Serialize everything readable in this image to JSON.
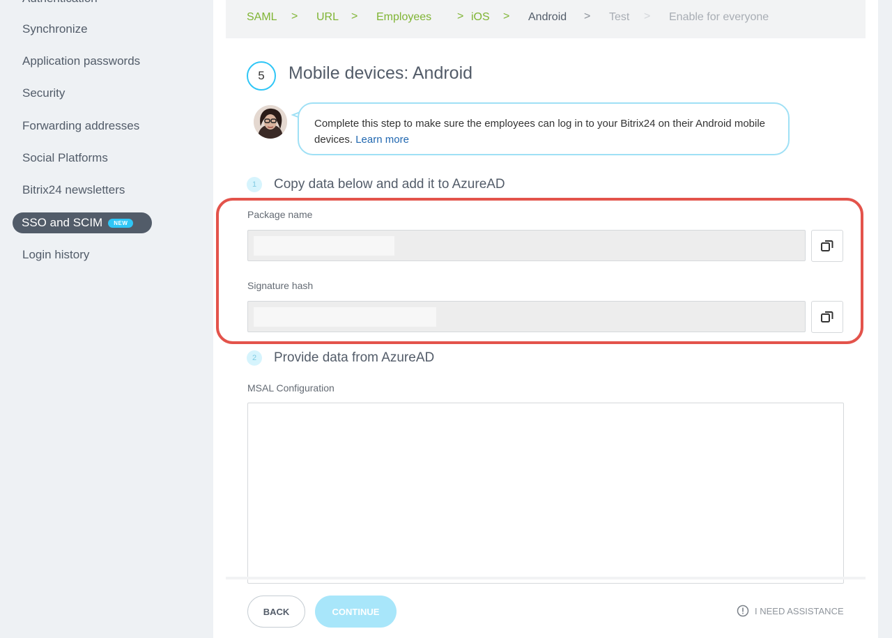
{
  "sidebar": {
    "items": [
      {
        "label": "Authentication"
      },
      {
        "label": "Synchronize"
      },
      {
        "label": "Application passwords"
      },
      {
        "label": "Security"
      },
      {
        "label": "Forwarding addresses"
      },
      {
        "label": "Social Platforms"
      },
      {
        "label": "Bitrix24 newsletters"
      },
      {
        "label": "SSO and SCIM",
        "badge": "NEW",
        "active": true
      },
      {
        "label": "Login history"
      }
    ]
  },
  "breadcrumb": {
    "steps": [
      {
        "label": "SAML",
        "state": "done"
      },
      {
        "label": "URL",
        "state": "done"
      },
      {
        "label": "Employees",
        "state": "done"
      },
      {
        "label": "iOS",
        "state": "done"
      },
      {
        "label": "Android",
        "state": "current"
      },
      {
        "label": "Test",
        "state": "future"
      },
      {
        "label": "Enable for everyone",
        "state": "future"
      }
    ],
    "separator": ">"
  },
  "step": {
    "number": "5",
    "title": "Mobile devices: Android"
  },
  "hint": {
    "text": "Complete this step to make sure the employees can log in to your Bitrix24 on their Android mobile devices.",
    "link": "Learn more"
  },
  "substep1": {
    "number": "1",
    "title": "Copy data below and add it to AzureAD"
  },
  "fields": {
    "package_name": {
      "label": "Package name",
      "value": ""
    },
    "signature_hash": {
      "label": "Signature hash",
      "value": ""
    }
  },
  "substep2": {
    "number": "2",
    "title": "Provide data from AzureAD"
  },
  "msal": {
    "label": "MSAL Configuration",
    "value": ""
  },
  "footer": {
    "back": "BACK",
    "continue": "CONTINUE",
    "assist": "I NEED ASSISTANCE"
  },
  "colors": {
    "accent": "#2fc6f6",
    "done": "#7fb433",
    "highlight": "#e3534b",
    "link": "#2067b0"
  }
}
